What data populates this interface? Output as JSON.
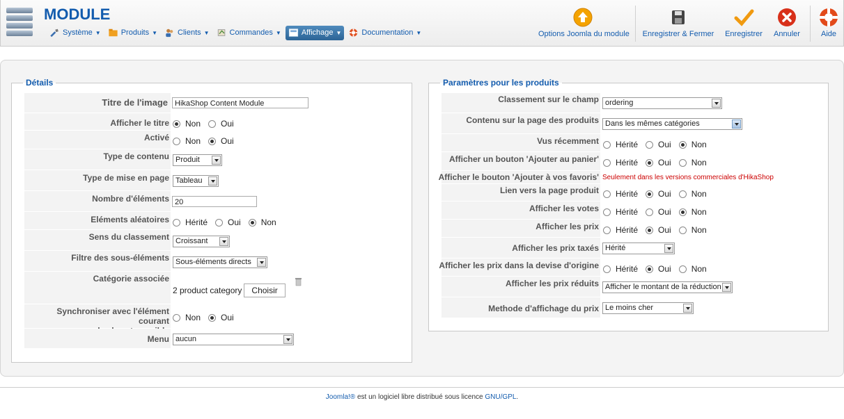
{
  "header": {
    "title": "MODULE",
    "menu": [
      {
        "label": "Système",
        "icon": "tools-icon"
      },
      {
        "label": "Produits",
        "icon": "folder-icon"
      },
      {
        "label": "Clients",
        "icon": "users-icon"
      },
      {
        "label": "Commandes",
        "icon": "cart-icon"
      },
      {
        "label": "Affichage",
        "icon": "display-icon",
        "active": true
      },
      {
        "label": "Documentation",
        "icon": "lifebuoy-icon"
      }
    ]
  },
  "toolbar": {
    "options": "Options Joomla du module",
    "save_close": "Enregistrer & Fermer",
    "save": "Enregistrer",
    "cancel": "Annuler",
    "help": "Aide"
  },
  "details": {
    "legend": "Détails",
    "rows": [
      {
        "label": "Titre de l'image",
        "value": "HikaShop Content Module"
      },
      {
        "label": "Afficher le titre",
        "options": [
          "Non",
          "Oui"
        ],
        "selected": "Non"
      },
      {
        "label": "Activé",
        "options": [
          "Non",
          "Oui"
        ],
        "selected": "Oui"
      },
      {
        "label": "Type de contenu",
        "value": "Produit"
      },
      {
        "label": "Type de mise en page",
        "value": "Tableau"
      },
      {
        "label": "Nombre d'éléments",
        "value": "20"
      },
      {
        "label": "Eléments aléatoires",
        "options": [
          "Hérité",
          "Oui",
          "Non"
        ],
        "selected": "Non"
      },
      {
        "label": "Sens du classement",
        "value": "Croissant"
      },
      {
        "label": "Filtre des sous-éléments",
        "value": "Sous-éléments directs"
      },
      {
        "label": "Catégorie associée",
        "value": "2 product category",
        "button": "Choisir"
      },
      {
        "label": "Synchroniser avec l'élément courant",
        "label2": "quand cela est possible",
        "options": [
          "Non",
          "Oui"
        ],
        "selected": "Oui"
      },
      {
        "label": "Menu",
        "value": "aucun"
      }
    ]
  },
  "products": {
    "legend": "Paramètres pour les produits",
    "rows": [
      {
        "label": "Classement sur le champ",
        "value": "ordering"
      },
      {
        "label": "Contenu sur la page des produits",
        "value": "Dans les mêmes catégories"
      },
      {
        "label": "Vus récemment",
        "options": [
          "Hérité",
          "Oui",
          "Non"
        ],
        "selected": "Non"
      },
      {
        "label": "Afficher un bouton 'Ajouter au panier'",
        "options": [
          "Hérité",
          "Oui",
          "Non"
        ],
        "selected": "Oui"
      },
      {
        "label": "Afficher le bouton 'Ajouter à vos favoris'",
        "note": "Seulement dans les versions commerciales d'HikaShop"
      },
      {
        "label": "Lien vers la page produit",
        "options": [
          "Hérité",
          "Oui",
          "Non"
        ],
        "selected": "Oui"
      },
      {
        "label": "Afficher les votes",
        "options": [
          "Hérité",
          "Oui",
          "Non"
        ],
        "selected": "Non"
      },
      {
        "label": "Afficher les prix",
        "options": [
          "Hérité",
          "Oui",
          "Non"
        ],
        "selected": "Oui"
      },
      {
        "label": "Afficher les prix taxés",
        "value": "Hérité"
      },
      {
        "label": "Afficher les prix dans la devise d'origine",
        "options": [
          "Hérité",
          "Oui",
          "Non"
        ],
        "selected": "Oui"
      },
      {
        "label": "Afficher les prix réduits",
        "value": "Afficher le montant de la réduction"
      },
      {
        "label": "Methode d'affichage du prix",
        "value": "Le moins cher"
      }
    ]
  },
  "footer": {
    "link1": "Joomla!®",
    "text": " est un logiciel libre distribué sous licence ",
    "link2": "GNU/GPL",
    "end": "."
  },
  "colors": {
    "accent": "#135cae",
    "note": "#cc0000"
  }
}
